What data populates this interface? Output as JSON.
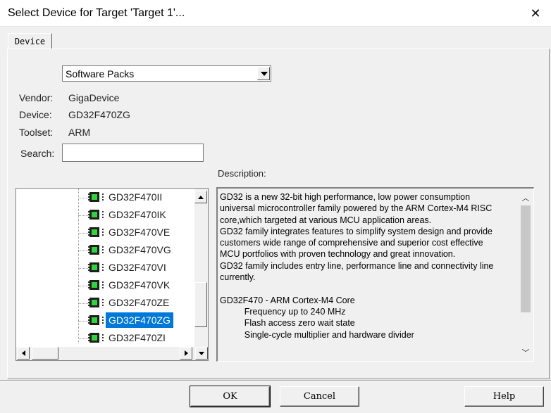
{
  "window": {
    "title": "Select Device for Target 'Target 1'...",
    "close_glyph": "✕"
  },
  "tabs": [
    {
      "label": "Device",
      "active": true
    }
  ],
  "source_select": {
    "selected": "Software Packs"
  },
  "device_info": {
    "vendor_label": "Vendor:",
    "vendor_value": "GigaDevice",
    "device_label": "Device:",
    "device_value": "GD32F470ZG",
    "toolset_label": "Toolset:",
    "toolset_value": "ARM",
    "search_label": "Search:",
    "search_value": ""
  },
  "device_tree": {
    "items": [
      {
        "label": "GD32F470II",
        "selected": false
      },
      {
        "label": "GD32F470IK",
        "selected": false
      },
      {
        "label": "GD32F470VE",
        "selected": false
      },
      {
        "label": "GD32F470VG",
        "selected": false
      },
      {
        "label": "GD32F470VI",
        "selected": false
      },
      {
        "label": "GD32F470VK",
        "selected": false
      },
      {
        "label": "GD32F470ZE",
        "selected": false
      },
      {
        "label": "GD32F470ZG",
        "selected": true
      },
      {
        "label": "GD32F470ZI",
        "selected": false
      }
    ],
    "icon": "chip-icon"
  },
  "description": {
    "label": "Description:",
    "text": "GD32 is a new 32-bit high performance, low power consumption\nuniversal microcontroller family powered by the ARM Cortex-M4 RISC\ncore,which targeted at various MCU application areas.\nGD32 family integrates features to simplify system design and provide\ncustomers wide range of comprehensive and superior cost effective\nMCU portfolios with proven technology and great innovation.\nGD32 family includes entry line, performance line and connectivity line\ncurrently.\n\nGD32F470 - ARM Cortex-M4 Core\n          Frequency up to 240 MHz\n          Flash access zero wait state\n          Single-cycle multiplier and hardware divider"
  },
  "buttons": {
    "ok": "OK",
    "cancel": "Cancel",
    "help": "Help"
  }
}
